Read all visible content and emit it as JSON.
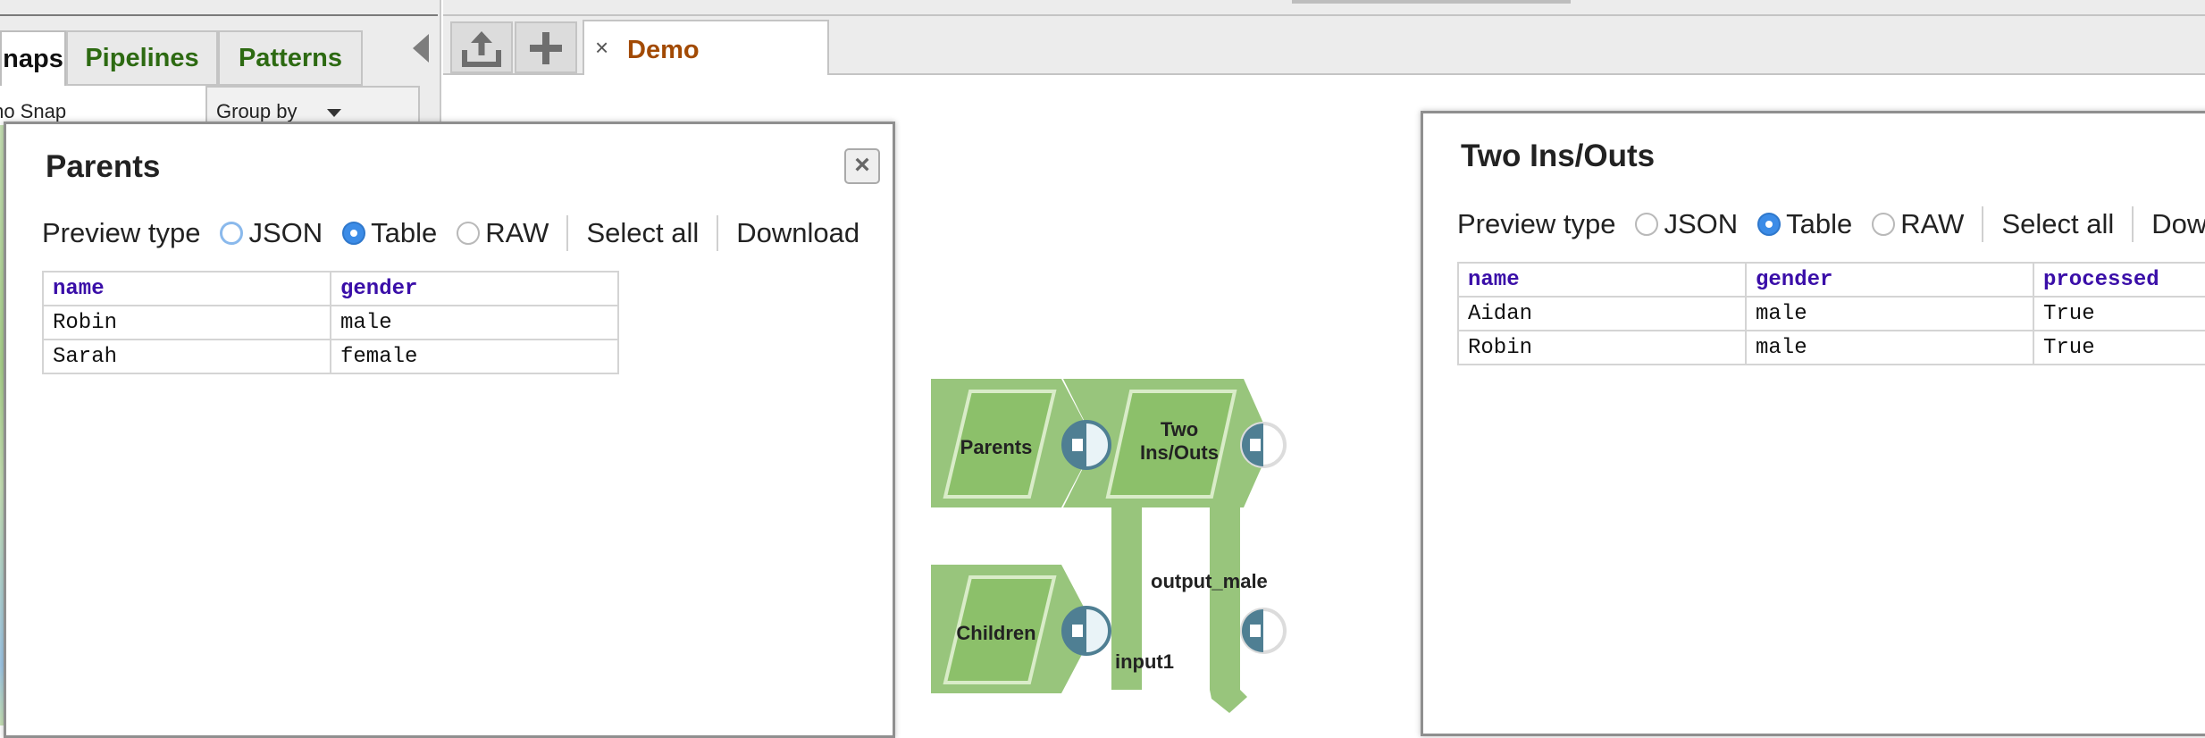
{
  "left_panel": {
    "tabs": [
      {
        "label": "naps"
      },
      {
        "label": "Pipelines"
      },
      {
        "label": "Patterns"
      }
    ],
    "list_item": "mo Snap",
    "group_by_label": "Group by"
  },
  "editor": {
    "tab_title": "Demo",
    "tab_close": "×"
  },
  "preview_parents": {
    "title": "Parents",
    "close": "×",
    "preview_type_label": "Preview type",
    "options": [
      "JSON",
      "Table",
      "RAW"
    ],
    "selected": "Table",
    "select_all": "Select all",
    "download": "Download",
    "columns": [
      "name",
      "gender"
    ],
    "rows": [
      [
        "Robin",
        "male"
      ],
      [
        "Sarah",
        "female"
      ]
    ]
  },
  "preview_two": {
    "title": "Two Ins/Outs",
    "preview_type_label": "Preview type",
    "options": [
      "JSON",
      "Table",
      "RAW"
    ],
    "selected": "Table",
    "select_all": "Select all",
    "download": "Down",
    "columns": [
      "name",
      "gender",
      "processed"
    ],
    "rows": [
      [
        "Aidan",
        "male",
        "True"
      ],
      [
        "Robin",
        "male",
        "True"
      ]
    ]
  },
  "pipeline": {
    "snaps": [
      {
        "label": "Parents"
      },
      {
        "label_line1": "Two",
        "label_line2": "Ins/Outs"
      },
      {
        "label": "Children"
      }
    ],
    "view_labels": {
      "output": "output_male",
      "input": "input1"
    }
  },
  "colors": {
    "tab_green": "#2d6a12",
    "doc_tab_orange": "#a24a04",
    "snap_green": "#8cc06a",
    "port_blue": "#4f7f93",
    "header_purple": "#3a0ea8",
    "radio_blue": "#3c8ce7"
  }
}
